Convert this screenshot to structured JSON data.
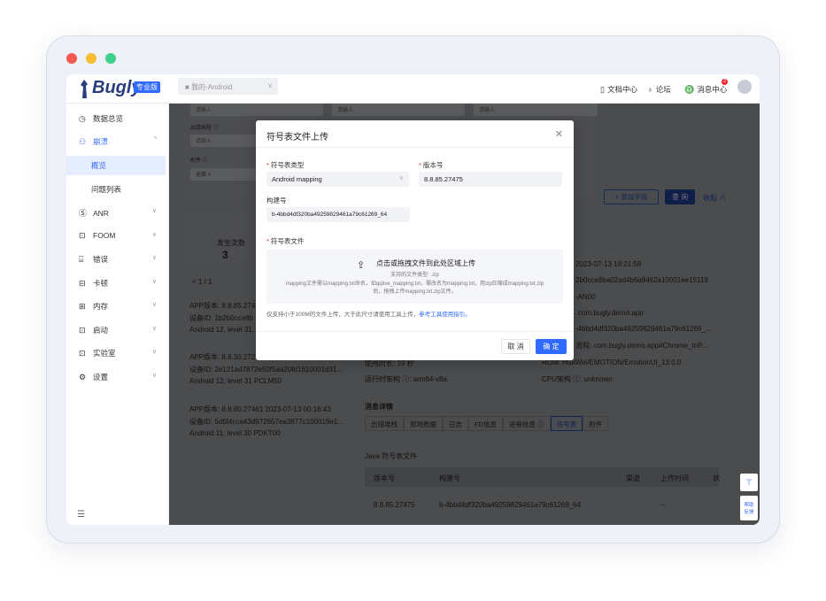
{
  "app": {
    "logo": "Bugly",
    "badge": "专业版",
    "project_selector": "■ 我的-Android"
  },
  "topnav": {
    "docs": "文档中心",
    "forum": "论坛",
    "messages": "消息中心",
    "messages_count": "2"
  },
  "sidebar": {
    "items": [
      {
        "label": "数据总览",
        "icon": "◷"
      },
      {
        "label": "崩溃",
        "icon": "⚇",
        "chev": "^"
      },
      {
        "label": "概览"
      },
      {
        "label": "问题列表"
      },
      {
        "label": "ANR",
        "icon": "Ⓢ",
        "chev": "∨"
      },
      {
        "label": "FOOM",
        "icon": "⊡",
        "chev": "∨"
      },
      {
        "label": "错误",
        "icon": "⌸",
        "chev": "∨"
      },
      {
        "label": "卡顿",
        "icon": "⊟",
        "chev": "∨"
      },
      {
        "label": "内存",
        "icon": "⊞",
        "chev": "∨"
      },
      {
        "label": "启动",
        "icon": "⊡",
        "chev": "∨"
      },
      {
        "label": "实验室",
        "icon": "⊡",
        "chev": "∨"
      },
      {
        "label": "设置",
        "icon": "⚙",
        "chev": "∨"
      }
    ]
  },
  "background": {
    "filter_placeholder": "请输入",
    "filter_label_thread": "出错线程 ⓘ",
    "filter_label_attach": "附件 ⓘ",
    "filter_all": "全部 ×",
    "add_field": "+ 添加字段",
    "query": "查 询",
    "collapse": "收起 ∧",
    "occurrences_label": "发生次数",
    "occurrences_value": "3",
    "pager": "< 1 / 1",
    "records": [
      {
        "line1": "APP版本: 8.8.85.274",
        "line2": "设备ID: 1b2b0cce8b",
        "line3": "Android 12, level 31"
      },
      {
        "line1": "APP版本: 8.8.30.272",
        "line2": "设备ID: 2e121ad7872e50f5aa20fd1610001d31...",
        "line3": "Android 12, level 31   PCLM50"
      },
      {
        "line1": "APP版本: 8.8.80.27461     2023-07-13 00:16:43",
        "line2": "设备ID: 5d5f4cca43d972657ea3877c100019e1...",
        "line3": "Android 11, level 30   PDKT00"
      }
    ],
    "details": [
      "2023-07-13 18:21:58",
      "2b0cce8ba02ad4b6a8462a10001ee15119",
      "-AN00",
      "com.bugly.demo.app",
      "-4bbd4df320ba49259829461a79c61269_...",
      "流程: com.bugly.demo.app#Chrome_InP..."
    ],
    "run_time": "使用时长: 19 秒",
    "rom": "ROM: HuaWei/EMOTION/EmotionUI_13.0.0",
    "arch": "运行时架构 ⓘ: arm64-v8a",
    "cpu_arch": "CPU架构 ⓘ: unknown",
    "section_title": "消息详情",
    "tabs": [
      "出错堆栈",
      "现场数据",
      "日志",
      "FD信息",
      "进程信息 ⓘ",
      "符号表",
      "附件"
    ],
    "java_symbols": "Java 符号表文件",
    "table_headers": [
      "版本号",
      "构建号",
      "渠道",
      "上传时间",
      "状"
    ],
    "table_row": [
      "8.8.85.27475",
      "b-4bbd4df320ba49259829461a79c61269_64",
      "--"
    ],
    "float_help": "帮助\n反馈"
  },
  "modal": {
    "title": "符号表文件上传",
    "type_label": "符号表类型",
    "type_value": "Android mapping",
    "version_label": "版本号",
    "version_value": "8.8.85.27475",
    "build_label": "构建号",
    "build_value": "b-4bbd4df320ba49259829461a79c61269_64",
    "file_label": "符号表文件",
    "upload_main": "点击或拖拽文件到此处区域上传",
    "upload_types": "支持的文件类型: .zip",
    "upload_desc1": "mapping文件需以mapping.txt命名，如qqlive_mapping.txt，需改名为mapping.txt，用zip压缩成mapping.txt.zip",
    "upload_desc2": "后，拖拽上传mapping.txt.zip文件。",
    "note": "仅支持小于100M的文件上传，大于此尺寸请使用工具上传，",
    "note_link": "参考工具使用指引。",
    "cancel": "取 消",
    "ok": "确 定"
  }
}
